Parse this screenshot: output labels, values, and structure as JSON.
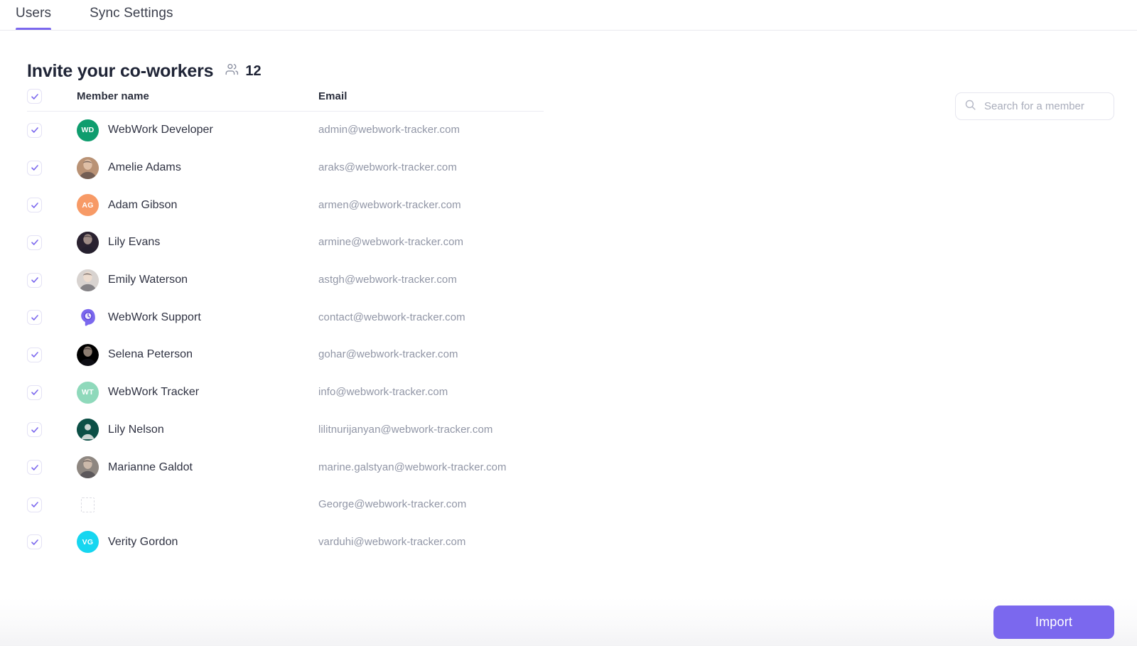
{
  "tabs": [
    {
      "label": "Users",
      "active": true
    },
    {
      "label": "Sync Settings",
      "active": false
    }
  ],
  "header": {
    "title": "Invite your co-workers",
    "member_count": "12",
    "people_icon": "people-icon"
  },
  "search": {
    "placeholder": "Search for a member",
    "value": "",
    "icon": "search-icon"
  },
  "table": {
    "headers": {
      "member_name": "Member name",
      "email": "Email"
    },
    "select_all_checked": true,
    "rows": [
      {
        "name": "WebWork Developer",
        "email": "admin@webwork-tracker.com",
        "checked": true,
        "avatar": {
          "type": "initials",
          "initials": "WD",
          "color": "#0f9d6e"
        }
      },
      {
        "name": "Amelie Adams",
        "email": "araks@webwork-tracker.com",
        "checked": true,
        "avatar": {
          "type": "photo",
          "color": "#b99275"
        }
      },
      {
        "name": "Adam Gibson",
        "email": "armen@webwork-tracker.com",
        "checked": true,
        "avatar": {
          "type": "initials",
          "initials": "AG",
          "color": "#f79a66"
        }
      },
      {
        "name": "Lily Evans",
        "email": "armine@webwork-tracker.com",
        "checked": true,
        "avatar": {
          "type": "photo",
          "color": "#2a2230"
        }
      },
      {
        "name": "Emily Waterson",
        "email": "astgh@webwork-tracker.com",
        "checked": true,
        "avatar": {
          "type": "photo",
          "color": "#d8d3d0"
        }
      },
      {
        "name": "WebWork Support",
        "email": "contact@webwork-tracker.com",
        "checked": true,
        "avatar": {
          "type": "logo",
          "color": "#7b68ee"
        }
      },
      {
        "name": "Selena Peterson",
        "email": "gohar@webwork-tracker.com",
        "checked": true,
        "avatar": {
          "type": "photo",
          "color": "#c3a municipality"
        }
      },
      {
        "name": "WebWork Tracker",
        "email": "info@webwork-tracker.com",
        "checked": true,
        "avatar": {
          "type": "initials",
          "initials": "WT",
          "color": "#8fd9bb"
        }
      },
      {
        "name": "Lily Nelson",
        "email": "lilitnurijanyan@webwork-tracker.com",
        "checked": true,
        "avatar": {
          "type": "person",
          "color": "#0c4f46"
        }
      },
      {
        "name": "Marianne Galdot",
        "email": "marine.galstyan@webwork-tracker.com",
        "checked": true,
        "avatar": {
          "type": "photo",
          "color": "#8e8781"
        }
      },
      {
        "name": "",
        "email": "George@webwork-tracker.com",
        "checked": true,
        "avatar": {
          "type": "broken",
          "color": "#ffffff"
        }
      },
      {
        "name": "Verity Gordon",
        "email": "varduhi@webwork-tracker.com",
        "checked": true,
        "avatar": {
          "type": "initials",
          "initials": "VG",
          "color": "#16d6f0"
        }
      }
    ]
  },
  "footer": {
    "import_label": "Import"
  },
  "colors": {
    "accent": "#7b68ee",
    "title": "#1f2436",
    "muted": "#9196a6"
  }
}
